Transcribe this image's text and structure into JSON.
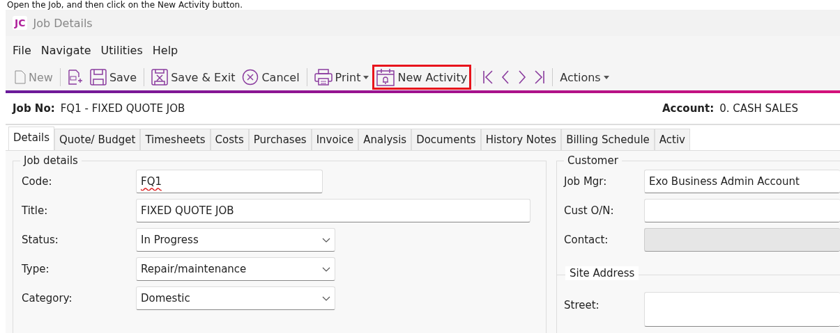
{
  "caption": "Open the Job, and then click on the New Activity button.",
  "window": {
    "logo": "JC",
    "title": "Job Details"
  },
  "menu": [
    "File",
    "Navigate",
    "Utilities",
    "Help"
  ],
  "toolbar": [
    {
      "kind": "new",
      "label": "New",
      "disabled": true,
      "highlighted": false
    },
    {
      "kind": "separator"
    },
    {
      "kind": "numbered",
      "disabled": false,
      "highlighted": false
    },
    {
      "kind": "save",
      "label": "Save",
      "disabled": false,
      "highlighted": false
    },
    {
      "kind": "separator"
    },
    {
      "kind": "saveexit",
      "label": "Save & Exit",
      "disabled": false,
      "highlighted": false
    },
    {
      "kind": "cancel",
      "label": "Cancel",
      "disabled": false,
      "highlighted": false
    },
    {
      "kind": "separator"
    },
    {
      "kind": "print",
      "label": "Print",
      "dropdown": true,
      "disabled": false,
      "highlighted": false
    },
    {
      "kind": "calendar",
      "label": "New Activity",
      "disabled": false,
      "highlighted": true
    },
    {
      "kind": "separator"
    },
    {
      "kind": "first",
      "disabled": false,
      "highlighted": false
    },
    {
      "kind": "prev",
      "disabled": false,
      "highlighted": false
    },
    {
      "kind": "next",
      "disabled": false,
      "highlighted": false
    },
    {
      "kind": "last",
      "disabled": false,
      "highlighted": false
    },
    {
      "kind": "separator"
    },
    {
      "kind": "plain",
      "label": "Actions",
      "dropdown": true,
      "disabled": false,
      "highlighted": false
    }
  ],
  "header": {
    "job_label": "Job No:",
    "job_value": "FQ1 - FIXED QUOTE JOB",
    "account_label": "Account:",
    "account_value": "0. CASH SALES"
  },
  "tabs": [
    {
      "label": "Details",
      "selected": true
    },
    {
      "label": "Quote/ Budget",
      "selected": false
    },
    {
      "label": "Timesheets",
      "selected": false
    },
    {
      "label": "Costs",
      "selected": false
    },
    {
      "label": "Purchases",
      "selected": false
    },
    {
      "label": "Invoice",
      "selected": false
    },
    {
      "label": "Analysis",
      "selected": false
    },
    {
      "label": "Documents",
      "selected": false
    },
    {
      "label": "History Notes",
      "selected": false
    },
    {
      "label": "Billing Schedule",
      "selected": false
    },
    {
      "label": "Activ",
      "selected": false
    }
  ],
  "job_details": {
    "title": "Job details",
    "fields": [
      {
        "kind": "text",
        "label": "Code:",
        "value": "FQ1",
        "misspelled": true
      },
      {
        "kind": "text",
        "label": "Title:",
        "value": "FIXED QUOTE JOB",
        "misspelled": false
      },
      {
        "kind": "select",
        "label": "Status:",
        "value": "In Progress"
      },
      {
        "kind": "select",
        "label": "Type:",
        "value": "Repair/maintenance"
      },
      {
        "kind": "select",
        "label": "Category:",
        "value": "Domestic"
      }
    ]
  },
  "customer": {
    "title": "Customer",
    "fields": [
      {
        "kind": "select",
        "label": "Job Mgr:",
        "value": "Exo Business Admin Account",
        "disabled": false
      },
      {
        "kind": "text",
        "label": "Cust O/N:",
        "disabled": false
      },
      {
        "kind": "text",
        "label": "Contact:",
        "disabled": true
      }
    ]
  },
  "site_address": {
    "title": "Site Address",
    "fields": [
      {
        "kind": "text",
        "label": "Street:",
        "disabled": false
      }
    ]
  }
}
